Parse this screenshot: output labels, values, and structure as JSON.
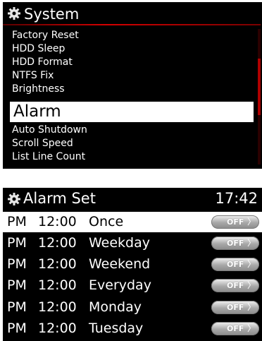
{
  "system_menu": {
    "title": "System",
    "icon": "gear-icon",
    "items": [
      {
        "label": "Factory Reset"
      },
      {
        "label": "HDD Sleep"
      },
      {
        "label": "HDD Format"
      },
      {
        "label": "NTFS Fix"
      },
      {
        "label": "Brightness"
      },
      {
        "label": "Alarm"
      },
      {
        "label": "Auto Shutdown"
      },
      {
        "label": "Scroll Speed"
      },
      {
        "label": "List Line Count"
      }
    ],
    "selected_label": "Alarm"
  },
  "alarm_set": {
    "title": "Alarm Set",
    "icon": "gear-icon",
    "clock": "17:42",
    "rows": [
      {
        "ampm": "PM",
        "time": "12:00",
        "repeat": "Once",
        "toggle": "OFF"
      },
      {
        "ampm": "PM",
        "time": "12:00",
        "repeat": "Weekday",
        "toggle": "OFF"
      },
      {
        "ampm": "PM",
        "time": "12:00",
        "repeat": "Weekend",
        "toggle": "OFF"
      },
      {
        "ampm": "PM",
        "time": "12:00",
        "repeat": "Everyday",
        "toggle": "OFF"
      },
      {
        "ampm": "PM",
        "time": "12:00",
        "repeat": "Monday",
        "toggle": "OFF"
      },
      {
        "ampm": "PM",
        "time": "12:00",
        "repeat": "Tuesday",
        "toggle": "OFF"
      }
    ],
    "toggle_arrow": "〉"
  },
  "colors": {
    "background": "#000000",
    "accent_red": "#d40000",
    "selection": "#ffffff"
  }
}
